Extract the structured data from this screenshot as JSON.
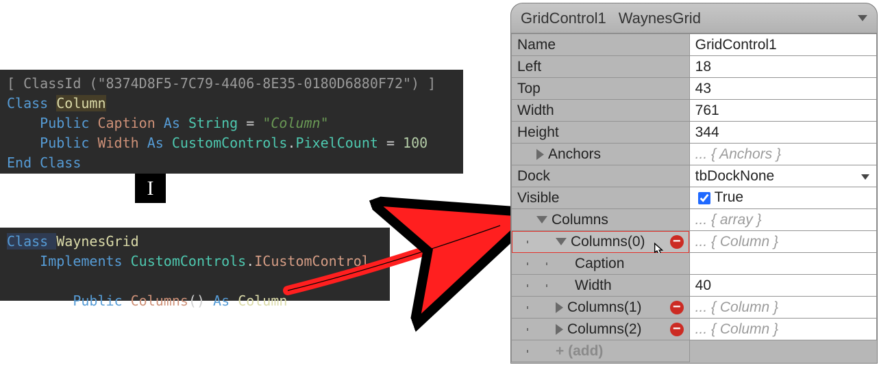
{
  "code1": {
    "line1_open": "[ ",
    "line1_classid": "ClassId",
    "line1_rest": " (\"8374D8F5-7C79-4406-8E35-0180D6880F72\") ]",
    "line2_kw": "Class ",
    "line2_name": "Column",
    "line3_indent": "    ",
    "line3_public": "Public ",
    "line3_caption": "Caption",
    "line3_as": " As ",
    "line3_type": "String",
    "line3_eq": " = ",
    "line3_str": "\"Column\"",
    "line4_indent": "    ",
    "line4_public": "Public ",
    "line4_width": "Width",
    "line4_as": " As ",
    "line4_ns": "CustomControls",
    "line4_dot": ".",
    "line4_type": "PixelCount",
    "line4_eq": " = ",
    "line4_num": "100",
    "line5": "End Class"
  },
  "caret_glyph": "I",
  "code2": {
    "line1_kw": "Class ",
    "line1_name": "WaynesGrid",
    "line2_indent": "    ",
    "line2_kw": "Implements ",
    "line2_ns": "CustomControls",
    "line2_dot": ".",
    "line2_iface": "ICustomControl",
    "line3_indent": "        ",
    "line3_public": "Public ",
    "line3_name": "Columns",
    "line3_parens": "()",
    "line3_as": " As ",
    "line3_type": "Column"
  },
  "inspector": {
    "header": {
      "object": "GridControl1",
      "class": "WaynesGrid"
    },
    "rows": {
      "name": {
        "label": "Name",
        "value": "GridControl1"
      },
      "left": {
        "label": "Left",
        "value": "18"
      },
      "top": {
        "label": "Top",
        "value": "43"
      },
      "width": {
        "label": "Width",
        "value": "761"
      },
      "height": {
        "label": "Height",
        "value": "344"
      },
      "anchors": {
        "label": "Anchors",
        "value": "... { Anchors }"
      },
      "dock": {
        "label": "Dock",
        "value": "tbDockNone"
      },
      "visible": {
        "label": "Visible",
        "value": "True"
      },
      "columns": {
        "label": "Columns",
        "value": "... { array }"
      },
      "col0": {
        "label": "Columns(0)",
        "value": "... { Column }"
      },
      "col0_caption": {
        "label": "Caption",
        "value": ""
      },
      "col0_width": {
        "label": "Width",
        "value": "40"
      },
      "col1": {
        "label": "Columns(1)",
        "value": "... { Column }"
      },
      "col2": {
        "label": "Columns(2)",
        "value": "... { Column }"
      },
      "add": {
        "label": "+ (add)"
      }
    }
  }
}
